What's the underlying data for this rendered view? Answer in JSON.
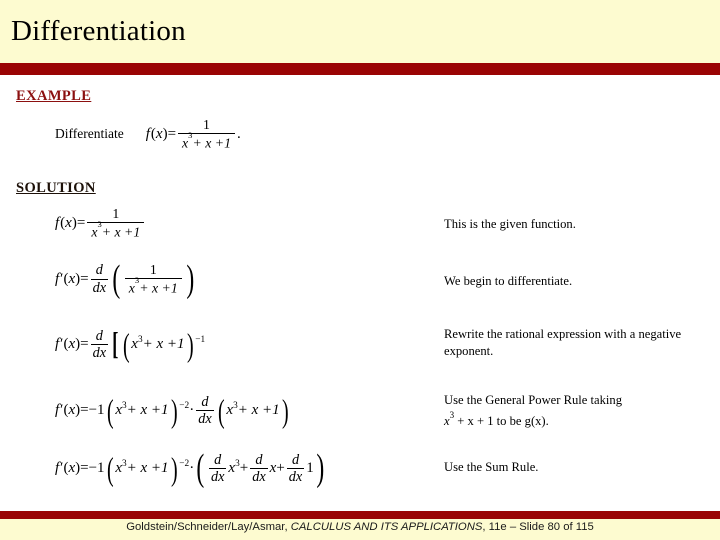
{
  "slide": {
    "title": "Differentiation",
    "accent_color": "#9a0404",
    "header_bg": "#fdfbd0",
    "body_bg": "#ffffff"
  },
  "example": {
    "heading": "EXAMPLE",
    "heading_color": "#8c1010",
    "prompt_label": "Differentiate",
    "formula_plain": "f(x) = 1/(x^3 + x + 1).",
    "parts": {
      "fn": "f",
      "arg_open": "(",
      "arg": "x",
      "arg_close": ")",
      "equals": "=",
      "numerator": "1",
      "denominator_base": "x",
      "denominator_exp": "3",
      "denominator_rest": "+ x + 1",
      "period": "."
    }
  },
  "solution": {
    "heading": "SOLUTION",
    "heading_color": "#1c1008",
    "steps": [
      {
        "equation_plain": "f(x) = 1/(x^3 + x + 1)",
        "note": "This is the given function."
      },
      {
        "equation_plain": "f'(x) = d/dx ( 1/(x^3 + x + 1) )",
        "note": "We begin to differentiate."
      },
      {
        "equation_plain": "f'(x) = d/dx [ (x^3 + x + 1)^-1 ]",
        "note": "Rewrite the rational expression with a negative exponent."
      },
      {
        "equation_plain": "f'(x) = -1(x^3 + x + 1)^-2 . d/dx (x^3 + x + 1)",
        "note_line1": "Use the General Power Rule taking",
        "note_line2_pre": "x",
        "note_line2_exp": "3",
        "note_line2_post": " + x + 1 to be g(x)."
      },
      {
        "equation_plain": "f'(x) = -1(x^3 + x + 1)^-2 . ( d/dx x^3 + d/dx x + d/dx 1 )",
        "note": "Use the Sum Rule."
      }
    ],
    "tokens": {
      "f": "f",
      "fprime": "f′",
      "x": "x",
      "open": "(",
      "close": ")",
      "equals": "=",
      "one": "1",
      "minus_one": "−1",
      "exp3": "3",
      "exp_neg1": "−1",
      "exp_neg2": "−2",
      "plus": "+",
      "dot": "·",
      "d": "d",
      "dx": "dx",
      "poly_rest": "+ x +1",
      "bracket_open": "[",
      "bracket_close": "]"
    }
  },
  "footer": {
    "authors": "Goldstein/Schneider/Lay/Asmar,",
    "book": "CALCULUS AND ITS APPLICATIONS",
    "edition_slide": ", 11e – Slide 80 of 115"
  }
}
